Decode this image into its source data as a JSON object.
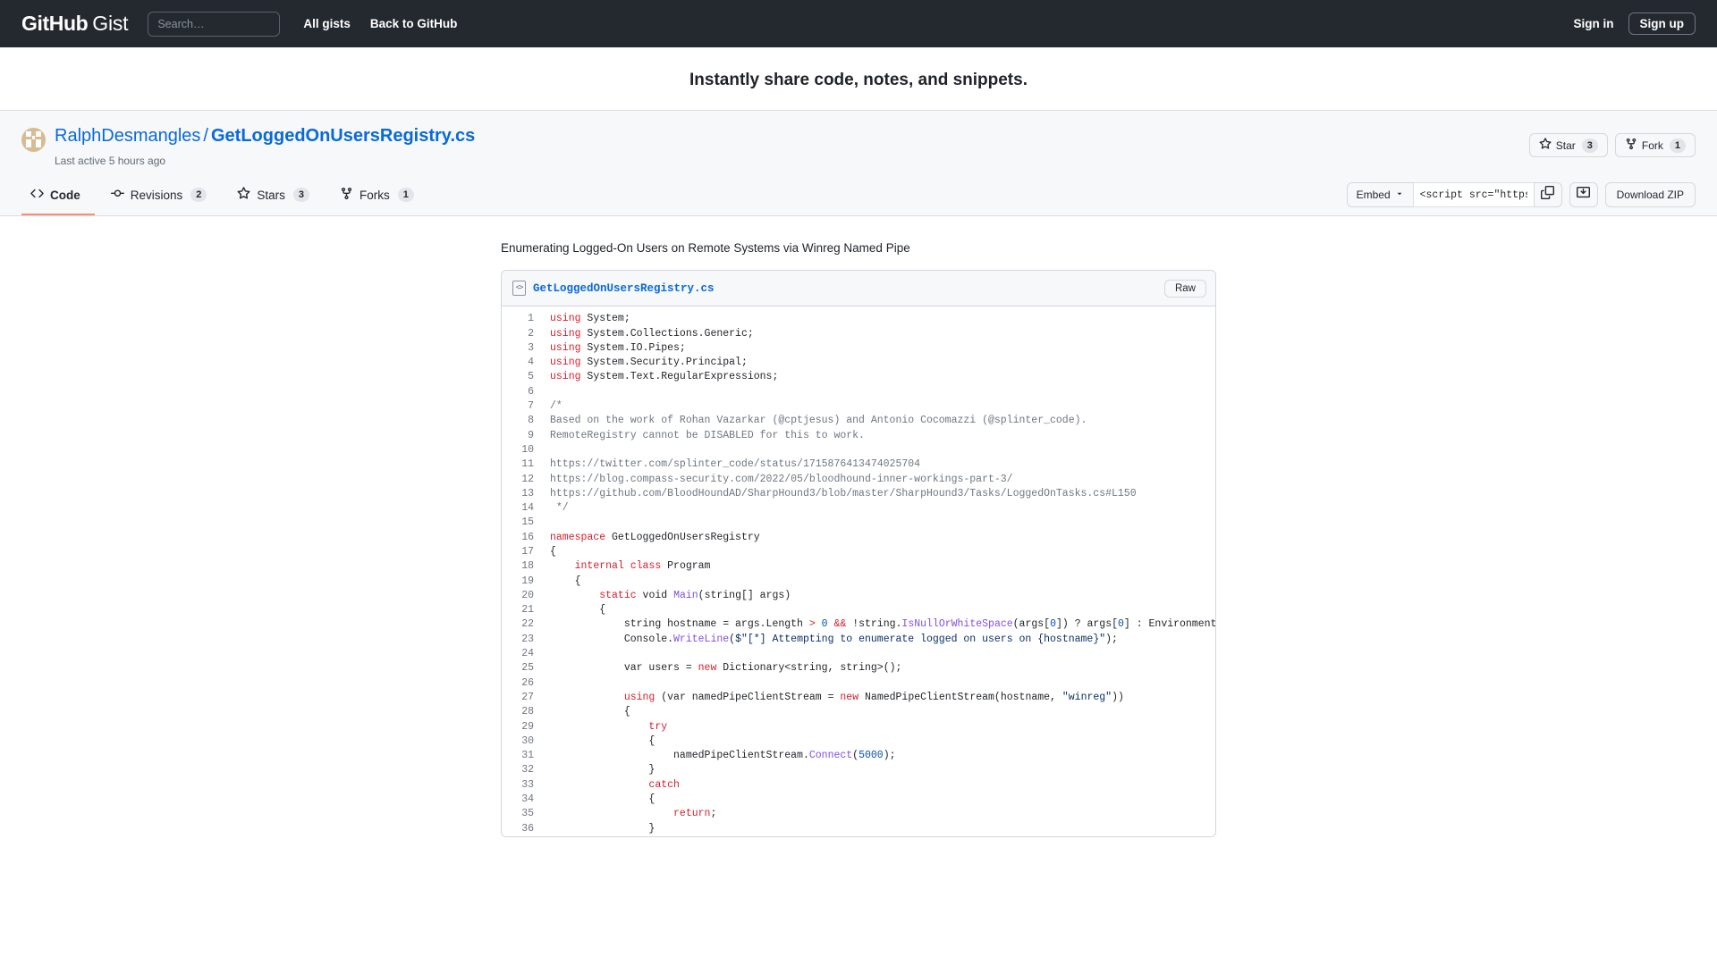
{
  "topnav": {
    "logo_primary": "GitHub",
    "logo_secondary": "Gist",
    "search_placeholder": "Search…",
    "search_value": "",
    "links": [
      {
        "label": "All gists",
        "name": "all-gists"
      },
      {
        "label": "Back to GitHub",
        "name": "back-to-github"
      }
    ],
    "sign_in": "Sign in",
    "sign_up": "Sign up"
  },
  "tagline": "Instantly share code, notes, and snippets.",
  "gist": {
    "owner": "RalphDesmangles",
    "separator": "/",
    "filename": "GetLoggedOnUsersRegistry.cs",
    "last_active": "Last active 5 hours ago",
    "star_label": "Star",
    "star_count": "3",
    "fork_label": "Fork",
    "fork_count": "1",
    "description": "Enumerating Logged-On Users on Remote Systems via Winreg Named Pipe"
  },
  "tabs": [
    {
      "label": "Code",
      "count": "",
      "icon": "code-icon",
      "active": true
    },
    {
      "label": "Revisions",
      "count": "2",
      "icon": "revisions-icon",
      "active": false
    },
    {
      "label": "Stars",
      "count": "3",
      "icon": "star-icon",
      "active": false
    },
    {
      "label": "Forks",
      "count": "1",
      "icon": "fork-icon",
      "active": false
    }
  ],
  "embed": {
    "select_label": "Embed",
    "script_value": "<script src=\"https://g",
    "download_zip": "Download ZIP"
  },
  "file": {
    "name": "GetLoggedOnUsersRegistry.cs",
    "raw_label": "Raw",
    "icon": "code-file-icon"
  },
  "colors": {
    "nav_bg": "#24292f",
    "header_bg": "#f6f8fa",
    "link_blue": "#0969da",
    "active_tab_underline": "#fd8c73",
    "keyword_red": "#cf222e",
    "string_navy": "#0a3069",
    "comment_gray": "#6e7781",
    "function_purple": "#8250df",
    "number_blue": "#0550ae"
  },
  "code_lines": [
    {
      "n": "1",
      "tokens": [
        {
          "t": "using",
          "c": "k"
        },
        {
          "t": " System;",
          "c": ""
        }
      ]
    },
    {
      "n": "2",
      "tokens": [
        {
          "t": "using",
          "c": "k"
        },
        {
          "t": " System.Collections.Generic;",
          "c": ""
        }
      ]
    },
    {
      "n": "3",
      "tokens": [
        {
          "t": "using",
          "c": "k"
        },
        {
          "t": " System.IO.Pipes;",
          "c": ""
        }
      ]
    },
    {
      "n": "4",
      "tokens": [
        {
          "t": "using",
          "c": "k"
        },
        {
          "t": " System.Security.Principal;",
          "c": ""
        }
      ]
    },
    {
      "n": "5",
      "tokens": [
        {
          "t": "using",
          "c": "k"
        },
        {
          "t": " System.Text.RegularExpressions;",
          "c": ""
        }
      ]
    },
    {
      "n": "6",
      "tokens": []
    },
    {
      "n": "7",
      "tokens": [
        {
          "t": "/*",
          "c": "c"
        }
      ]
    },
    {
      "n": "8",
      "tokens": [
        {
          "t": "Based on the work of Rohan Vazarkar (@cptjesus) and Antonio Cocomazzi (@splinter_code).",
          "c": "c"
        }
      ]
    },
    {
      "n": "9",
      "tokens": [
        {
          "t": "RemoteRegistry cannot be DISABLED for this to work.",
          "c": "c"
        }
      ]
    },
    {
      "n": "10",
      "tokens": []
    },
    {
      "n": "11",
      "tokens": [
        {
          "t": "https://twitter.com/splinter_code/status/1715876413474025704",
          "c": "c"
        }
      ]
    },
    {
      "n": "12",
      "tokens": [
        {
          "t": "https://blog.compass-security.com/2022/05/bloodhound-inner-workings-part-3/",
          "c": "c"
        }
      ]
    },
    {
      "n": "13",
      "tokens": [
        {
          "t": "https://github.com/BloodHoundAD/SharpHound3/blob/master/SharpHound3/Tasks/LoggedOnTasks.cs#L150",
          "c": "c"
        }
      ]
    },
    {
      "n": "14",
      "tokens": [
        {
          "t": " */",
          "c": "c"
        }
      ]
    },
    {
      "n": "15",
      "tokens": []
    },
    {
      "n": "16",
      "tokens": [
        {
          "t": "namespace",
          "c": "k"
        },
        {
          "t": " GetLoggedOnUsersRegistry",
          "c": ""
        }
      ]
    },
    {
      "n": "17",
      "tokens": [
        {
          "t": "{",
          "c": ""
        }
      ]
    },
    {
      "n": "18",
      "tokens": [
        {
          "t": "    ",
          "c": ""
        },
        {
          "t": "internal class",
          "c": "k"
        },
        {
          "t": " Program",
          "c": ""
        }
      ]
    },
    {
      "n": "19",
      "tokens": [
        {
          "t": "    {",
          "c": ""
        }
      ]
    },
    {
      "n": "20",
      "tokens": [
        {
          "t": "        ",
          "c": ""
        },
        {
          "t": "static",
          "c": "k"
        },
        {
          "t": " void ",
          "c": ""
        },
        {
          "t": "Main",
          "c": "fn"
        },
        {
          "t": "(string[] args)",
          "c": ""
        }
      ]
    },
    {
      "n": "21",
      "tokens": [
        {
          "t": "        {",
          "c": ""
        }
      ]
    },
    {
      "n": "22",
      "tokens": [
        {
          "t": "            string hostname = args.Length ",
          "c": ""
        },
        {
          "t": ">",
          "c": "op"
        },
        {
          "t": " ",
          "c": ""
        },
        {
          "t": "0",
          "c": "n"
        },
        {
          "t": " ",
          "c": ""
        },
        {
          "t": "&&",
          "c": "op"
        },
        {
          "t": " !string.",
          "c": ""
        },
        {
          "t": "IsNullOrWhiteSpace",
          "c": "fn"
        },
        {
          "t": "(args[",
          "c": ""
        },
        {
          "t": "0",
          "c": "n"
        },
        {
          "t": "]) ? args[",
          "c": ""
        },
        {
          "t": "0",
          "c": "n"
        },
        {
          "t": "] : Environment.MachineName;",
          "c": ""
        }
      ]
    },
    {
      "n": "23",
      "tokens": [
        {
          "t": "            Console.",
          "c": ""
        },
        {
          "t": "WriteLine",
          "c": "fn"
        },
        {
          "t": "(",
          "c": ""
        },
        {
          "t": "$\"[*] Attempting to enumerate logged on users on {hostname}\"",
          "c": "s"
        },
        {
          "t": ");",
          "c": ""
        }
      ]
    },
    {
      "n": "24",
      "tokens": []
    },
    {
      "n": "25",
      "tokens": [
        {
          "t": "            var users = ",
          "c": ""
        },
        {
          "t": "new",
          "c": "k"
        },
        {
          "t": " Dictionary<string, string>();",
          "c": ""
        }
      ]
    },
    {
      "n": "26",
      "tokens": []
    },
    {
      "n": "27",
      "tokens": [
        {
          "t": "            ",
          "c": ""
        },
        {
          "t": "using",
          "c": "k"
        },
        {
          "t": " (var namedPipeClientStream = ",
          "c": ""
        },
        {
          "t": "new",
          "c": "k"
        },
        {
          "t": " NamedPipeClientStream(hostname, ",
          "c": ""
        },
        {
          "t": "\"winreg\"",
          "c": "s"
        },
        {
          "t": "))",
          "c": ""
        }
      ]
    },
    {
      "n": "28",
      "tokens": [
        {
          "t": "            {",
          "c": ""
        }
      ]
    },
    {
      "n": "29",
      "tokens": [
        {
          "t": "                ",
          "c": ""
        },
        {
          "t": "try",
          "c": "k"
        }
      ]
    },
    {
      "n": "30",
      "tokens": [
        {
          "t": "                {",
          "c": ""
        }
      ]
    },
    {
      "n": "31",
      "tokens": [
        {
          "t": "                    namedPipeClientStream.",
          "c": ""
        },
        {
          "t": "Connect",
          "c": "fn"
        },
        {
          "t": "(",
          "c": ""
        },
        {
          "t": "5000",
          "c": "n"
        },
        {
          "t": ");",
          "c": ""
        }
      ]
    },
    {
      "n": "32",
      "tokens": [
        {
          "t": "                }",
          "c": ""
        }
      ]
    },
    {
      "n": "33",
      "tokens": [
        {
          "t": "                ",
          "c": ""
        },
        {
          "t": "catch",
          "c": "k"
        }
      ]
    },
    {
      "n": "34",
      "tokens": [
        {
          "t": "                {",
          "c": ""
        }
      ]
    },
    {
      "n": "35",
      "tokens": [
        {
          "t": "                    ",
          "c": ""
        },
        {
          "t": "return",
          "c": "k"
        },
        {
          "t": ";",
          "c": ""
        }
      ]
    },
    {
      "n": "36",
      "tokens": [
        {
          "t": "                }",
          "c": ""
        }
      ]
    }
  ]
}
